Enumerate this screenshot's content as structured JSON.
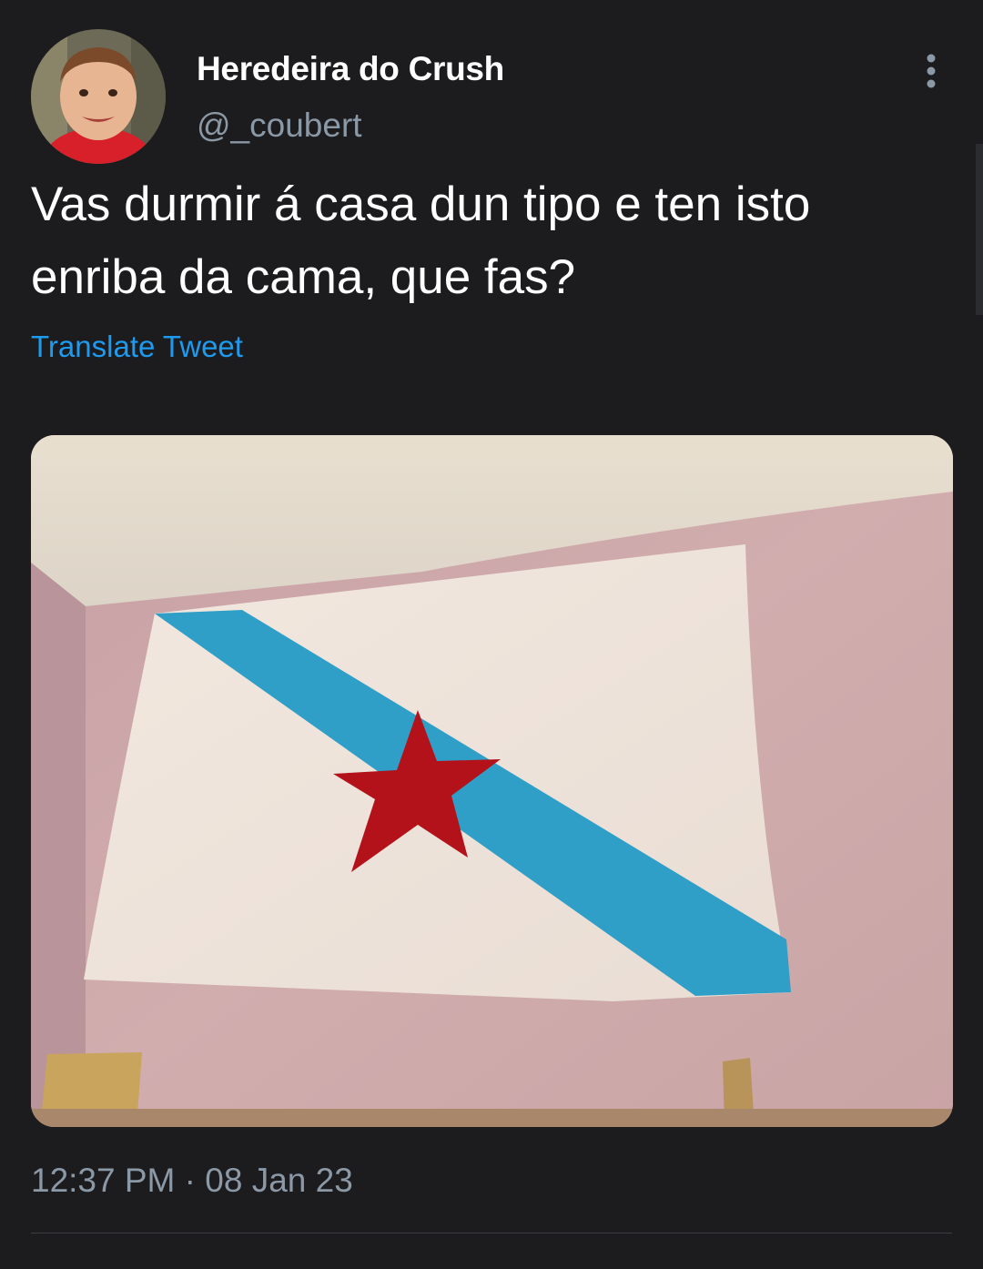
{
  "tweet": {
    "display_name": "Heredeira do Crush",
    "handle": "@_coubert",
    "text": "Vas durmir á casa dun tipo e ten isto enriba da cama, que fas?",
    "translate_label": "Translate Tweet",
    "time": "12:37 PM",
    "separator": "·",
    "date": "08 Jan 23",
    "more_icon": "more-vertical-icon",
    "avatar_icon": "avatar"
  },
  "colors": {
    "background": "#1c1c1e",
    "link": "#1d9bf0",
    "secondary_text": "#8b98a5",
    "flag_stripe": "#2f9fc7",
    "flag_star": "#b4121b"
  }
}
